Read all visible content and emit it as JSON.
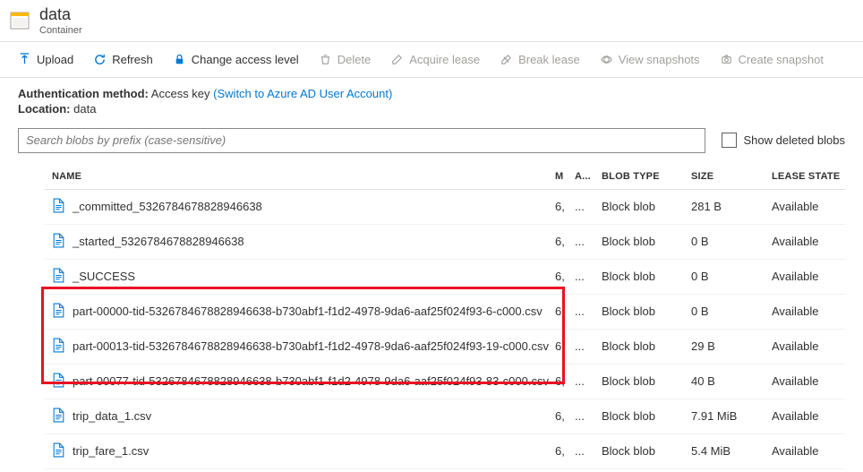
{
  "header": {
    "title": "data",
    "subtitle": "Container"
  },
  "toolbar": {
    "upload": "Upload",
    "refresh": "Refresh",
    "change_access": "Change access level",
    "delete": "Delete",
    "acquire_lease": "Acquire lease",
    "break_lease": "Break lease",
    "view_snapshots": "View snapshots",
    "create_snapshot": "Create snapshot"
  },
  "meta": {
    "auth_label": "Authentication method:",
    "auth_value": "Access key",
    "auth_link": "(Switch to Azure AD User Account)",
    "loc_label": "Location:",
    "loc_value": "data"
  },
  "search": {
    "placeholder": "Search blobs by prefix (case-sensitive)",
    "show_deleted": "Show deleted blobs"
  },
  "columns": {
    "name": "NAME",
    "m": "M",
    "a": "A...",
    "btype": "BLOB TYPE",
    "size": "SIZE",
    "lease": "LEASE STATE"
  },
  "rows": [
    {
      "name": "_committed_5326784678828946638",
      "m": "6,",
      "a": "...",
      "btype": "Block blob",
      "size": "281 B",
      "lease": "Available"
    },
    {
      "name": "_started_5326784678828946638",
      "m": "6,",
      "a": "...",
      "btype": "Block blob",
      "size": "0 B",
      "lease": "Available"
    },
    {
      "name": "_SUCCESS",
      "m": "6,",
      "a": "...",
      "btype": "Block blob",
      "size": "0 B",
      "lease": "Available"
    },
    {
      "name": "part-00000-tid-5326784678828946638-b730abf1-f1d2-4978-9da6-aaf25f024f93-6-c000.csv",
      "m": "6,",
      "a": "...",
      "btype": "Block blob",
      "size": "0 B",
      "lease": "Available"
    },
    {
      "name": "part-00013-tid-5326784678828946638-b730abf1-f1d2-4978-9da6-aaf25f024f93-19-c000.csv",
      "m": "6,",
      "a": "...",
      "btype": "Block blob",
      "size": "29 B",
      "lease": "Available"
    },
    {
      "name": "part-00077-tid-5326784678828946638-b730abf1-f1d2-4978-9da6-aaf25f024f93-83-c000.csv",
      "m": "6,",
      "a": "...",
      "btype": "Block blob",
      "size": "40 B",
      "lease": "Available"
    },
    {
      "name": "trip_data_1.csv",
      "m": "6,",
      "a": "...",
      "btype": "Block blob",
      "size": "7.91 MiB",
      "lease": "Available"
    },
    {
      "name": "trip_fare_1.csv",
      "m": "6,",
      "a": "...",
      "btype": "Block blob",
      "size": "5.4 MiB",
      "lease": "Available"
    }
  ],
  "colors": {
    "link": "#0078d4",
    "highlight": "#e81123",
    "text": "#323130",
    "muted": "#a19f9d"
  }
}
